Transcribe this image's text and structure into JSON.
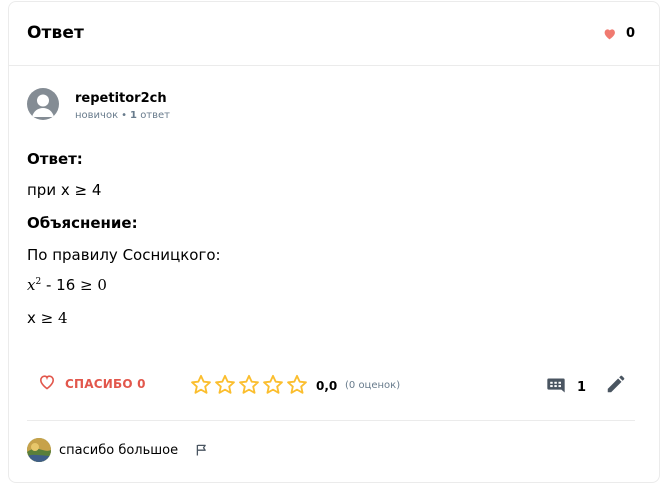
{
  "header": {
    "title": "Ответ",
    "likes_count": "0"
  },
  "author": {
    "username": "repetitor2ch",
    "rank": "новичок",
    "answers_count": "1",
    "answers_word": "ответ"
  },
  "answer": {
    "answer_label": "Ответ:",
    "answer_text": "при x ≥ 4",
    "explanation_label": "Объяснение:",
    "explanation_text": "По правилу Сосницкого:",
    "formula1_var": "x",
    "formula1_exp": "2",
    "formula1_rest": " - 16 ",
    "formula1_rel": "≥ 0",
    "formula2_var": "x ",
    "formula2_rel": "≥ 4"
  },
  "actions": {
    "thanks_label": "СПАСИБО 0",
    "rating_value": "0,0",
    "votes_text": "(0 оценок)",
    "comments_count": "1",
    "stars_total": 5
  },
  "comment": {
    "text": "спасибо большое"
  },
  "colors": {
    "accent_red": "#e2574c",
    "star_yellow": "#fbbe2e",
    "muted": "#687b8c",
    "icon_dark": "#4a5561"
  }
}
